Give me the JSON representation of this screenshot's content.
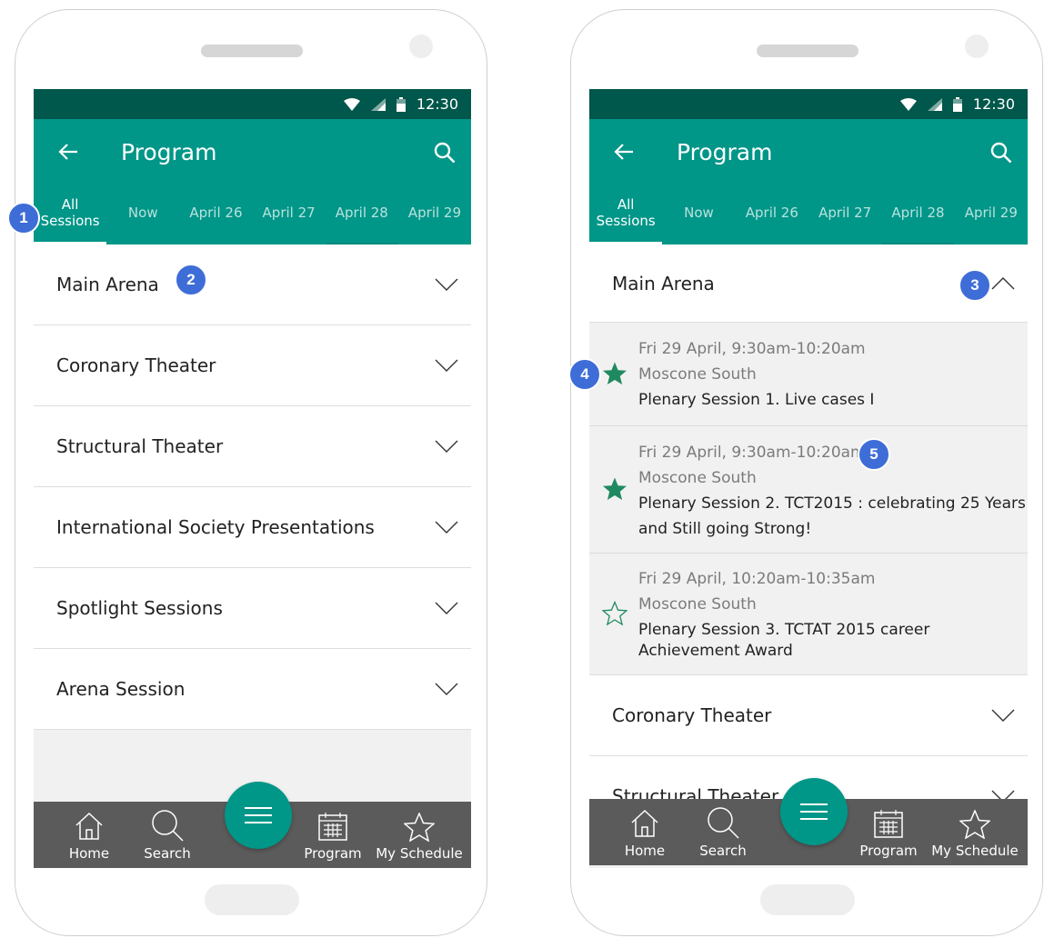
{
  "status_bar": {
    "time": "12:30"
  },
  "app_bar": {
    "title": "Program"
  },
  "tabs": [
    {
      "line1": "All",
      "line2": "Sessions"
    },
    {
      "line1": "Now",
      "line2": ""
    },
    {
      "line1": "April 26",
      "line2": ""
    },
    {
      "line1": "April 27",
      "line2": ""
    },
    {
      "line1": "April 28",
      "line2": ""
    },
    {
      "line1": "April 29",
      "line2": ""
    }
  ],
  "categories": [
    "Main Arena",
    "Coronary Theater",
    "Structural Theater",
    "International Society Presentations",
    "Spotlight Sessions",
    "Arena Session"
  ],
  "sessions": [
    {
      "time": "Fri 29 April, 9:30am-10:20am",
      "location": "Moscone South",
      "title": "Plenary Session 1. Live cases I",
      "starred": true
    },
    {
      "time": "Fri 29 April, 9:30am-10:20am",
      "location": "Moscone South",
      "title": "Plenary Session 2. TCT2015 : celebrating 25 Years and Still going Strong!",
      "starred": true
    },
    {
      "time": "Fri 29 April, 10:20am-10:35am",
      "location": "Moscone South",
      "title": "Plenary Session 3. TCTAT 2015 career Achievement Award",
      "starred": false
    }
  ],
  "bottom_nav": {
    "home": "Home",
    "search": "Search",
    "program": "Program",
    "my_schedule": "My Schedule"
  },
  "markers": [
    "1",
    "2",
    "3",
    "4",
    "5"
  ],
  "colors": {
    "primary": "#009688",
    "status_bar": "#00574b",
    "bottom_nav": "#5b5b5b",
    "star": "#1f8a60",
    "marker": "#3e6dd8"
  },
  "icons": {
    "back": "arrow-left-icon",
    "search": "search-icon",
    "expand": "chevron-down-icon",
    "collapse": "chevron-up-icon",
    "favorite": "star-icon",
    "menu": "hamburger-icon"
  }
}
